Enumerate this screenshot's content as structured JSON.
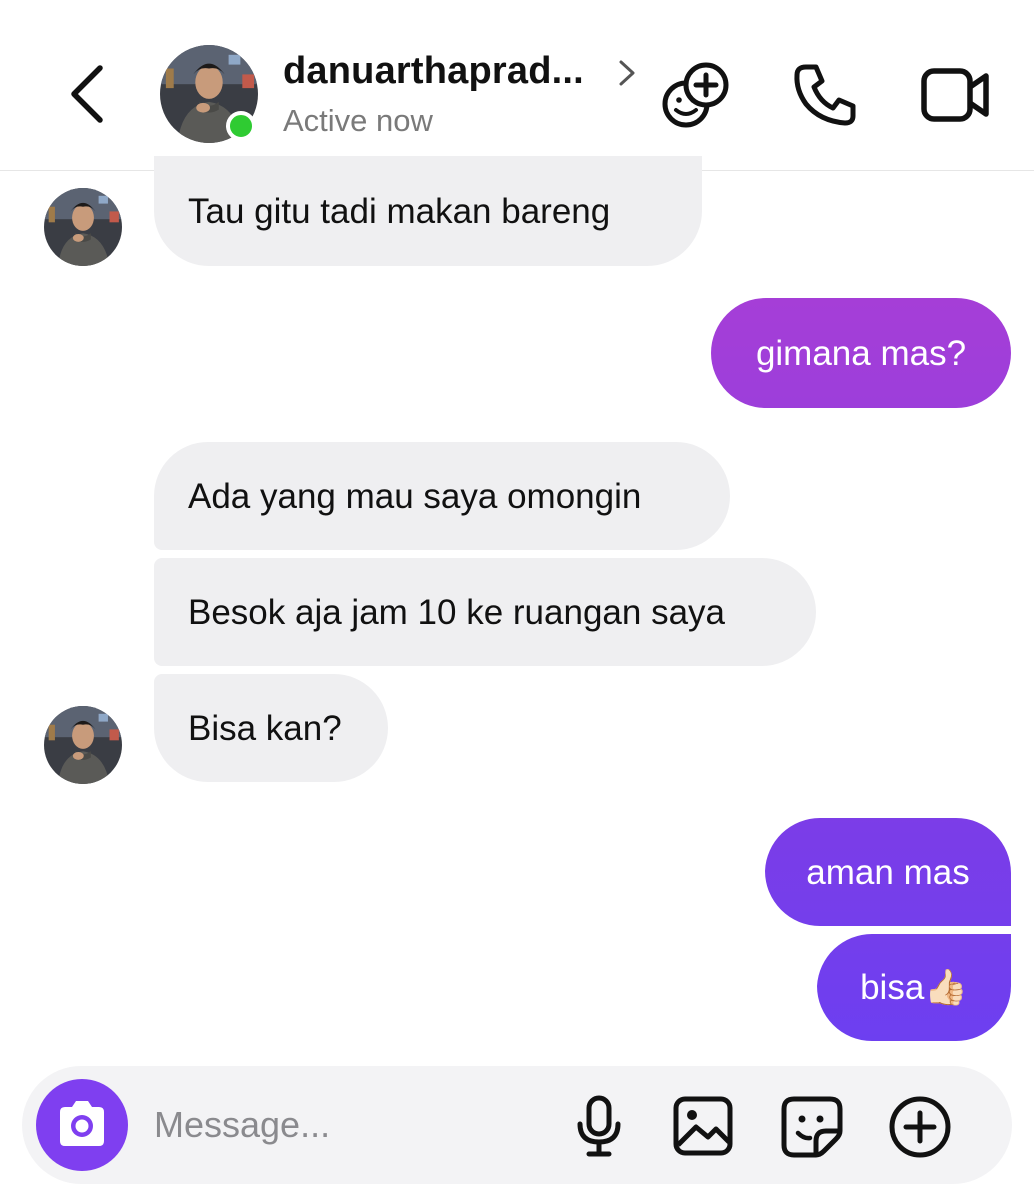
{
  "header": {
    "contact_name": "danuarthaprad...",
    "status": "Active now"
  },
  "messages": [
    {
      "direction": "incoming",
      "text": "Tau gitu tadi makan bareng"
    },
    {
      "direction": "outgoing",
      "text": "gimana mas?"
    },
    {
      "direction": "incoming",
      "text": "Ada yang mau saya omongin"
    },
    {
      "direction": "incoming",
      "text": "Besok aja jam 10 ke ruangan saya"
    },
    {
      "direction": "incoming",
      "text": "Bisa kan?"
    },
    {
      "direction": "outgoing",
      "text": "aman mas"
    },
    {
      "direction": "outgoing",
      "text": "bisa👍🏻"
    }
  ],
  "composer": {
    "placeholder": "Message...",
    "value": ""
  },
  "icons": {
    "back": "chevron-left-icon",
    "chevron": "chevron-right-icon",
    "add_people": "add-people-icon",
    "call": "phone-icon",
    "video": "video-camera-icon",
    "camera": "camera-icon",
    "mic": "microphone-icon",
    "gallery": "image-icon",
    "sticker": "sticker-icon",
    "more": "plus-circle-icon"
  },
  "colors": {
    "incoming_bubble": "#efeff1",
    "outgoing_gradient_top": "#a63fd8",
    "outgoing_gradient_bottom": "#6a3ff0",
    "online_indicator": "#2fcb32",
    "camera_button": "#7f3ff0"
  }
}
